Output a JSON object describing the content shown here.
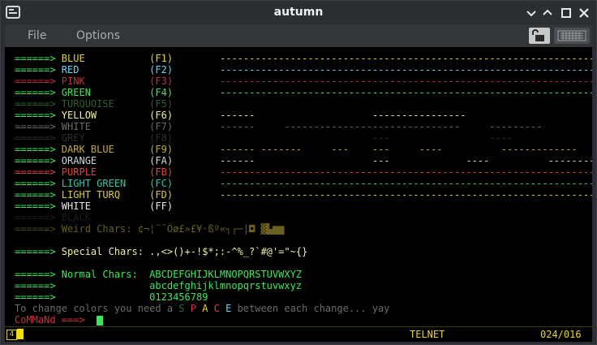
{
  "window": {
    "title": "autumn"
  },
  "menu": {
    "file": "File",
    "options": "Options"
  },
  "colors": {
    "blue": "#e8d22a",
    "red": "#5fd7ff",
    "pink": "#c8323c",
    "green": "#3ce85a",
    "turquoise": "#2f6e2f",
    "yellow": "#f0f0a0",
    "white": "#8a8a8a",
    "grey": "#3a3a3a",
    "darkblue": "#b8a02a",
    "orange": "#c8d8d8",
    "purple": "#e0443c",
    "lightgreen": "#2ac8a8",
    "lightturq": "#d8c848",
    "ffwhite": "#e8e8e8",
    "arrow": "#3ce85a",
    "cursor": "#3ce85a",
    "background": "#000000",
    "status": "#e8d22a"
  },
  "lines": [
    {
      "arrow": "======>",
      "name": "BLUE",
      "key": "(F1)",
      "dash": "-------------------------------------------------------------------------------",
      "c": "#e8d22a"
    },
    {
      "arrow": "======>",
      "name": "RED",
      "key": "(F2)",
      "dash": "-------------------------------------------------------------------------------",
      "c": "#5fd7ff"
    },
    {
      "arrow": "======>",
      "name": "PINK",
      "key": "(F3)",
      "dash": "-------------------------------------------------------------------------------",
      "c": "#b8323c"
    },
    {
      "arrow": "======>",
      "name": "GREEN",
      "key": "(F4)",
      "dash": "-------------------------------------------------------------------------------",
      "c": "#3ce85a"
    },
    {
      "arrow": "======>",
      "name": "TURQUOISE",
      "key": "(F5)",
      "dash": "",
      "c": "#2f5e2f"
    },
    {
      "arrow": "======>",
      "name": "YELLOW",
      "key": "(F6)",
      "dash": "------                    ----------------                        ----",
      "c": "#f0f0a0"
    },
    {
      "arrow": "======>",
      "name": "WHITE",
      "key": "(F7)",
      "dash": "------     ------------------------------     ---------          ---------",
      "c": "#6a6a6a"
    },
    {
      "arrow": "======>",
      "name": "GREY",
      "key": "(F8)",
      "dash": "                          ---                 ----",
      "c": "#2e2e2e"
    },
    {
      "arrow": "======>",
      "name": "DARK BLUE",
      "key": "(F9)",
      "dash": "------ -------     ---    ---     ----          -------------",
      "c": "#c8aa2a"
    },
    {
      "arrow": "======>",
      "name": "ORANGE",
      "key": "(FA)",
      "dash": "------                    ---             ----          ------------",
      "c": "#c8d8d8"
    },
    {
      "arrow": "======>",
      "name": "PURPLE",
      "key": "(FB)",
      "dash": "-------------------------------------------------------------------------------",
      "c": "#e0443c"
    },
    {
      "arrow": "======>",
      "name": "LIGHT GREEN",
      "key": "(FC)",
      "dash": "-------------------------------------------------------------------------------",
      "c": "#2ac8a8"
    },
    {
      "arrow": "======>",
      "name": "LIGHT TURQ",
      "key": "(FD)",
      "dash": "-------------------------------------------------------------------------------",
      "c": "#d8c848"
    },
    {
      "arrow": "======>",
      "name": "WHITE",
      "key": "(FF)",
      "dash": "",
      "c": "#e8e8e8"
    },
    {
      "arrow": "======>",
      "name": "BLACK",
      "key": "",
      "dash": "",
      "c": "#1c1c1c"
    }
  ],
  "weird": {
    "arrow": "======>",
    "label": "Weird Chars:",
    "chars": "¢¬¦¨¯Ôø£»£¥·ßº«┐┌─|◘ ▓▙▆▆"
  },
  "special": {
    "arrow": "======>",
    "label": "Special Chars:",
    "chars": ".,<>()+-!$*;:-^%_?`#@'=\"~{}"
  },
  "normal": {
    "arrow": "======>",
    "label": "Normal Chars:",
    "upper": "ABCDEFGHIJKLMNOPQRSTUVWXYZ",
    "lower": "abcdefghijklmnopqrstuvwxyz",
    "digits": "0123456789"
  },
  "change": {
    "prefix": "To change colors you need a",
    "space_letters": [
      "S",
      "P",
      "A",
      "C",
      "E"
    ],
    "suffix": "between each change... yay"
  },
  "command": {
    "prompt": "CoMMaNd ===>"
  },
  "status": {
    "icon": "4",
    "mode": "TELNET",
    "position": "024/016"
  }
}
